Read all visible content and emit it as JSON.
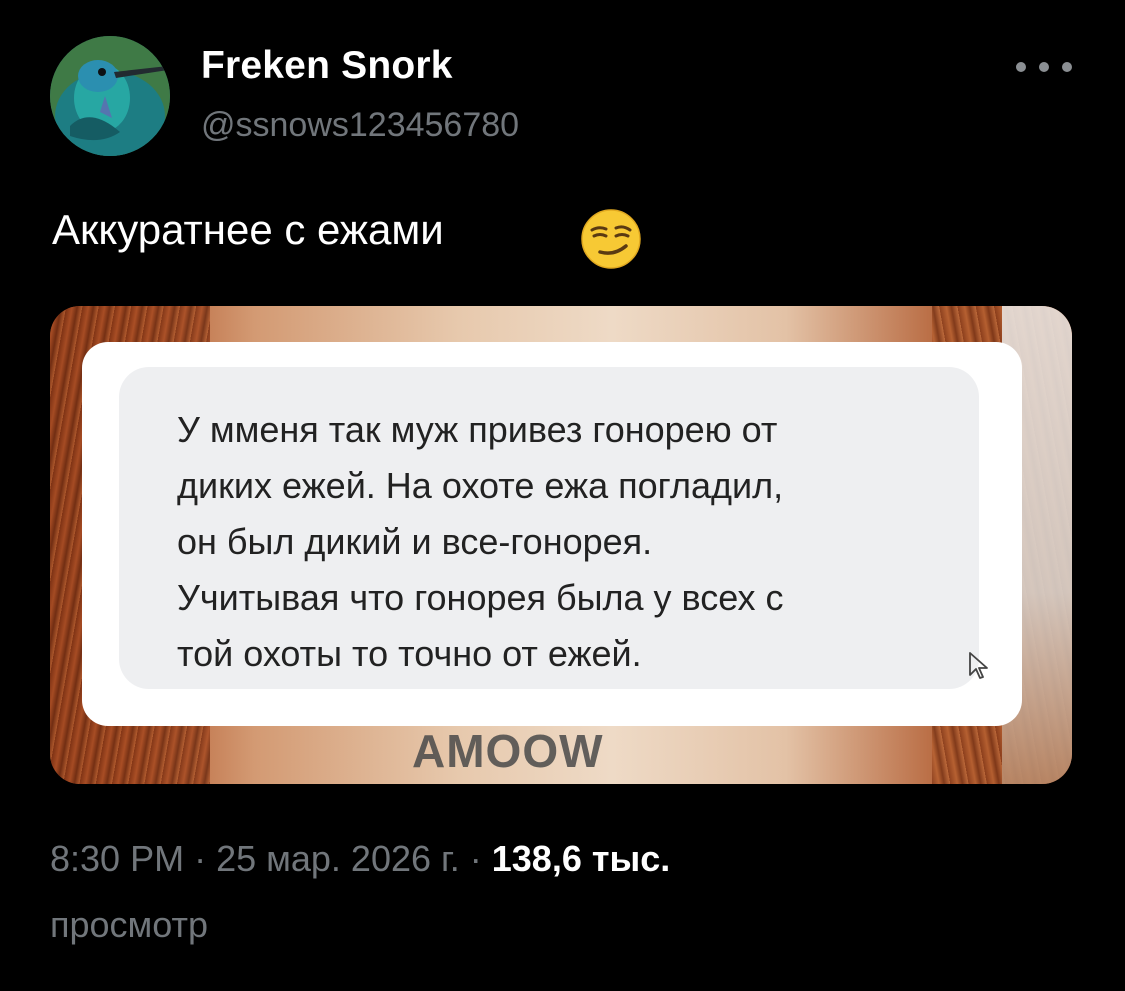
{
  "author": {
    "display_name": "Freken Snork",
    "handle": "@ssnows123456780",
    "avatar_icon": "hummingbird-avatar"
  },
  "more_icon": "ellipsis-icon",
  "tweet": {
    "text": "Аккуратнее с ежами",
    "emoji": "smirking-face-emoji"
  },
  "media": {
    "message_lines": [
      "У ммeня так муж привез гонорею от",
      "диких ежей. На охоте ежа погладил,",
      "он был дикий и все-гонорея.",
      "Учитывая что гонорея была у всех с",
      "той охоты то точно от ежей."
    ],
    "watermark": "AMOOW",
    "cursor_icon": "pointer-cursor-icon"
  },
  "meta": {
    "time": "8:30 PM",
    "separator": " · ",
    "date": "25 мар. 2026 г.",
    "views_count": "138,6 тыс.",
    "views_label": "просмотр"
  },
  "colors": {
    "background": "#000000",
    "primary_text": "#ffffff",
    "secondary_text": "#71767b"
  }
}
